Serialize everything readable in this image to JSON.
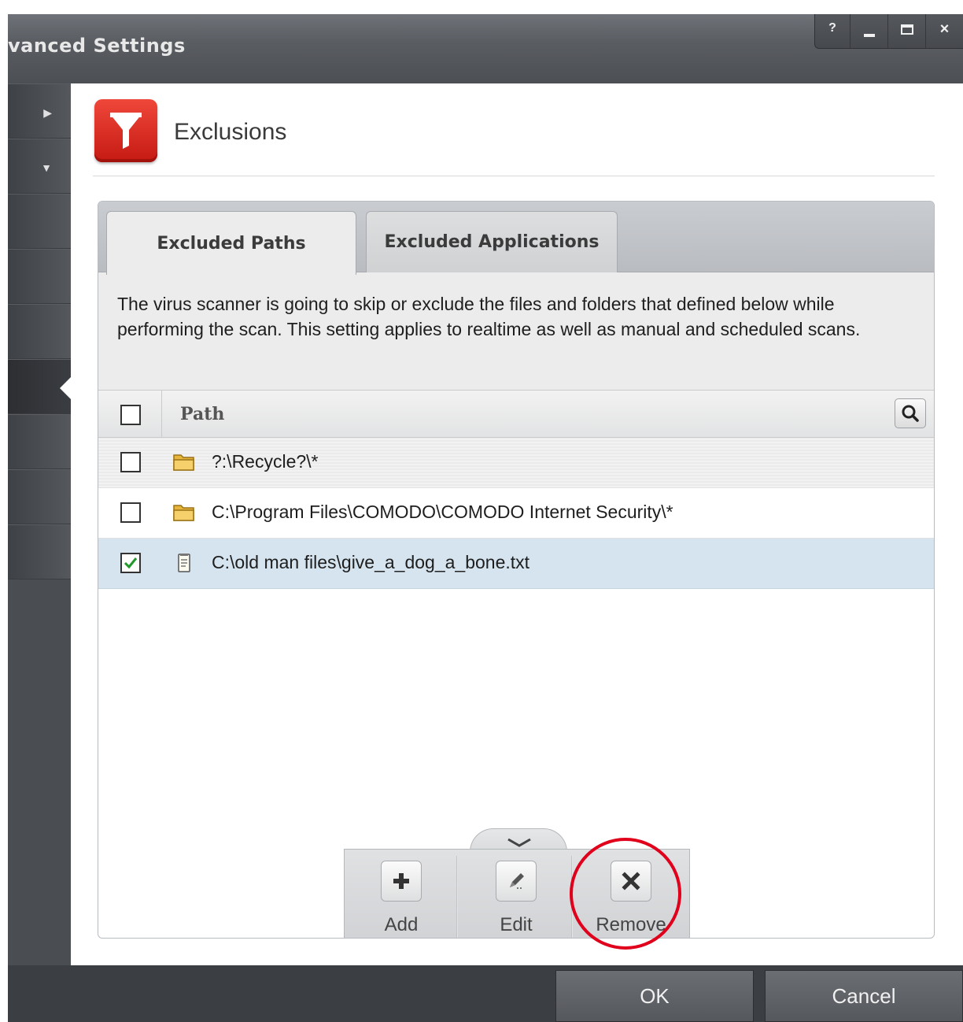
{
  "window": {
    "title": "vanced Settings",
    "controls": {
      "help": "?",
      "close": "×"
    }
  },
  "header": {
    "title": "Exclusions"
  },
  "tabs": [
    {
      "label": "Excluded Paths",
      "active": true
    },
    {
      "label": "Excluded Applications",
      "active": false
    }
  ],
  "description": "The virus scanner is going to skip or exclude the files and folders that defined below while performing the scan. This setting applies to realtime as well as manual and scheduled scans.",
  "grid": {
    "column_header": "Path",
    "rows": [
      {
        "path": "?:\\Recycle?\\*",
        "type": "folder",
        "checked": false
      },
      {
        "path": "C:\\Program Files\\COMODO\\COMODO Internet Security\\*",
        "type": "folder",
        "checked": false
      },
      {
        "path": "C:\\old man files\\give_a_dog_a_bone.txt",
        "type": "file",
        "checked": true
      }
    ]
  },
  "toolbar": {
    "add_label": "Add",
    "edit_label": "Edit",
    "remove_label": "Remove"
  },
  "footer": {
    "ok_label": "OK",
    "cancel_label": "Cancel"
  },
  "colors": {
    "accent_red": "#d9261c",
    "selected_row": "#d5e4ee",
    "highlight_circle": "#e0001b"
  }
}
